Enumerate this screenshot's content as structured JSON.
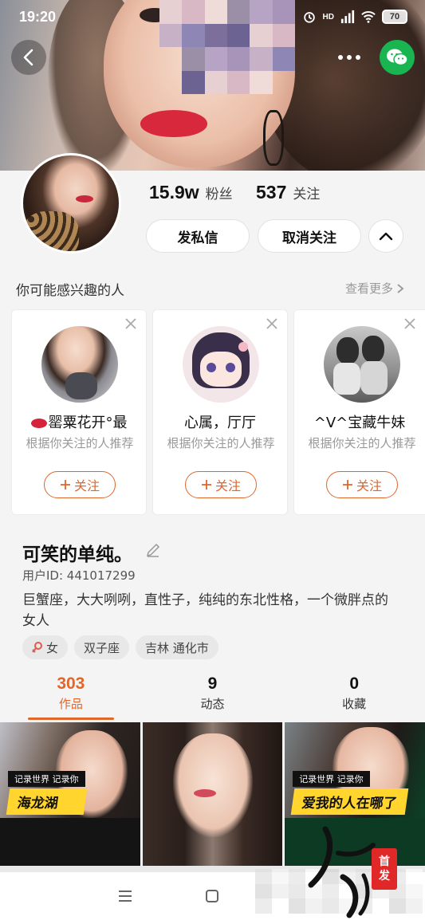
{
  "status_bar": {
    "time": "19:20",
    "battery": "70",
    "network_label": "HD"
  },
  "profile": {
    "fans_count": "15.9w",
    "fans_label": "粉丝",
    "following_count": "537",
    "following_label": "关注",
    "message_button": "发私信",
    "unfollow_button": "取消关注"
  },
  "recommendations": {
    "title": "你可能感兴趣的人",
    "more": "查看更多",
    "items": [
      {
        "name": "罂粟花开°最",
        "reason": "根据你关注的人推荐",
        "follow": "关注"
      },
      {
        "name": "心属，厅厅",
        "reason": "根据你关注的人推荐",
        "follow": "关注"
      },
      {
        "name": "^V^宝藏牛妹",
        "reason": "根据你关注的人推荐",
        "follow": "关注"
      }
    ]
  },
  "bio": {
    "nickname": "可笑的单纯。",
    "user_id": "用户ID: 441017299",
    "description": "巨蟹座，大大咧咧，直性子，纯纯的东北性格，一个微胖点的女人",
    "tags": [
      "女",
      "双子座",
      "吉林 通化市"
    ]
  },
  "tabs": [
    {
      "count": "303",
      "label": "作品",
      "active": true
    },
    {
      "count": "9",
      "label": "动态",
      "active": false
    },
    {
      "count": "0",
      "label": "收藏",
      "active": false
    }
  ],
  "works": [
    {
      "caption_top": "记录世界 记录你",
      "caption_main": "海龙湖"
    },
    {
      "caption_top": "",
      "caption_main": ""
    },
    {
      "caption_top": "记录世界 记录你",
      "caption_main": "爱我的人在哪了"
    }
  ],
  "watermark": {
    "stamp_top": "首",
    "stamp_bottom": "发"
  },
  "colors": {
    "accent": "#e0662a",
    "wechat": "#18b551",
    "caption_yellow": "#ffd52e"
  },
  "icons": {
    "back": "back-arrow-icon",
    "more": "more-dots-icon",
    "wechat": "wechat-icon",
    "collapse": "chevron-up-icon",
    "close": "close-icon",
    "edit": "pencil-icon",
    "gender": "female-icon",
    "nav_menu": "menu-lines-icon",
    "nav_home": "square-home-icon"
  }
}
